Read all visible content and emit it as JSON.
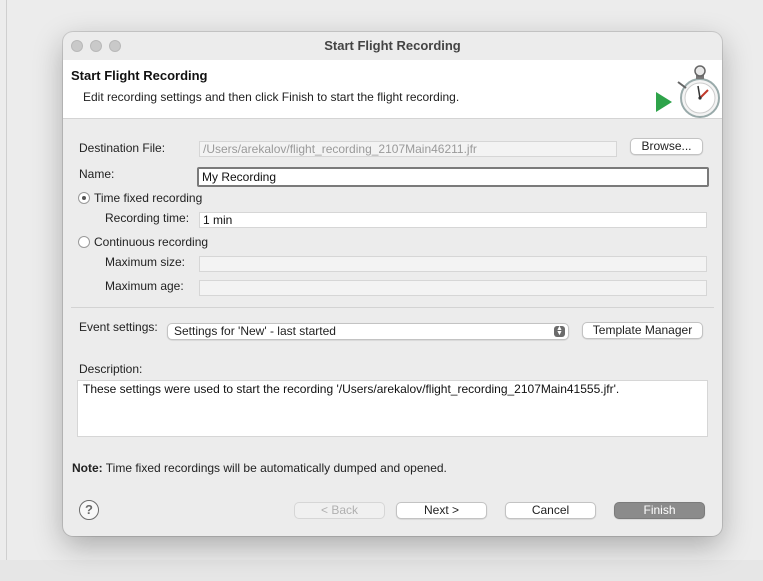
{
  "window": {
    "title": "Start Flight Recording"
  },
  "banner": {
    "title": "Start Flight Recording",
    "subtitle": "Edit recording settings and then click Finish to start the flight recording.",
    "icon": "stopwatch-record-icon"
  },
  "form": {
    "destination_label": "Destination File:",
    "destination_value": "/Users/arekalov/flight_recording_2107Main46211.jfr",
    "browse_label": "Browse...",
    "name_label": "Name:",
    "name_value": "My Recording",
    "time_fixed_label": "Time fixed recording",
    "time_fixed_selected": true,
    "recording_time_label": "Recording time:",
    "recording_time_value": "1 min",
    "continuous_label": "Continuous recording",
    "continuous_selected": false,
    "max_size_label": "Maximum size:",
    "max_size_value": "",
    "max_age_label": "Maximum age:",
    "max_age_value": "",
    "event_settings_label": "Event settings:",
    "event_settings_value": "Settings for 'New' - last started",
    "template_manager_label": "Template Manager",
    "description_label": "Description:",
    "description_value": "These settings were used to start the recording '/Users/arekalov/flight_recording_2107Main41555.jfr'."
  },
  "note": {
    "prefix": "Note:",
    "text": "Time fixed recordings will be automatically dumped and opened."
  },
  "footer": {
    "help_glyph": "?",
    "back_label": "< Back",
    "next_label": "Next >",
    "cancel_label": "Cancel",
    "finish_label": "Finish"
  }
}
